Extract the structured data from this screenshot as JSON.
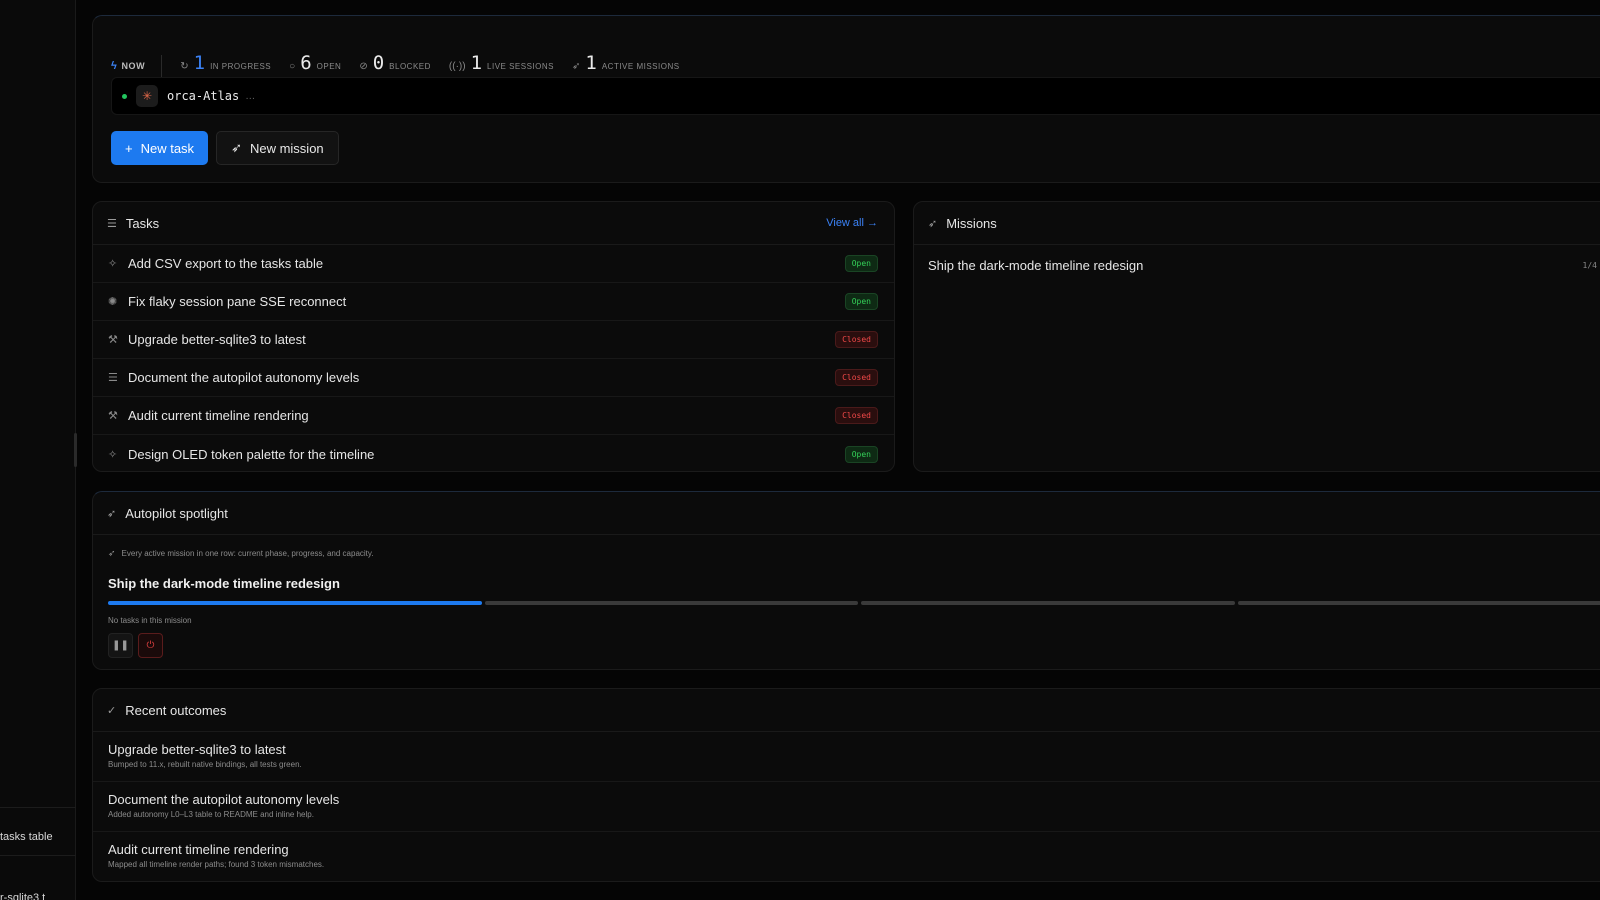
{
  "sidebar": {
    "rows": [
      "tasks table",
      "r-sqlite3 t"
    ]
  },
  "status": {
    "now_label": "NOW",
    "stats": [
      {
        "icon": "spinner-icon",
        "value": "1",
        "label": "IN PROGRESS"
      },
      {
        "icon": "circle-icon",
        "value": "6",
        "label": "OPEN"
      },
      {
        "icon": "blocked-icon",
        "value": "0",
        "label": "BLOCKED"
      },
      {
        "icon": "broadcast-icon",
        "value": "1",
        "label": "LIVE SESSIONS"
      },
      {
        "icon": "rocket-icon",
        "value": "1",
        "label": "ACTIVE MISSIONS"
      }
    ],
    "session": {
      "name": "orca-Atlas",
      "ellipsis": "…"
    },
    "buttons": {
      "new_task": "New task",
      "new_mission": "New mission"
    }
  },
  "tasks": {
    "title": "Tasks",
    "view_all": "View all →",
    "items": [
      {
        "icon": "sparkle-icon",
        "title": "Add CSV export to the tasks table",
        "status": "Open"
      },
      {
        "icon": "bug-icon",
        "title": "Fix flaky session pane SSE reconnect",
        "status": "Open"
      },
      {
        "icon": "wrench-icon",
        "title": "Upgrade better-sqlite3 to latest",
        "status": "Closed"
      },
      {
        "icon": "list-icon",
        "title": "Document the autopilot autonomy levels",
        "status": "Closed"
      },
      {
        "icon": "wrench-icon",
        "title": "Audit current timeline rendering",
        "status": "Closed"
      },
      {
        "icon": "sparkle-icon",
        "title": "Design OLED token palette for the timeline",
        "status": "Open"
      }
    ]
  },
  "missions": {
    "title": "Missions",
    "items": [
      {
        "title": "Ship the dark-mode timeline redesign",
        "progress": "1/4"
      }
    ]
  },
  "autopilot": {
    "title": "Autopilot spotlight",
    "description": "Every active mission in one row: current phase, progress, and capacity.",
    "mission_title": "Ship the dark-mode timeline redesign",
    "phases_total": 4,
    "phases_done": 1,
    "note": "No tasks in this mission"
  },
  "outcomes": {
    "title": "Recent outcomes",
    "items": [
      {
        "title": "Upgrade better-sqlite3 to latest",
        "detail": "Bumped to 11.x, rebuilt native bindings, all tests green."
      },
      {
        "title": "Document the autopilot autonomy levels",
        "detail": "Added autonomy L0–L3 table to README and inline help."
      },
      {
        "title": "Audit current timeline rendering",
        "detail": "Mapped all timeline render paths; found 3 token mismatches."
      }
    ]
  },
  "colors": {
    "accent": "#1d7af0",
    "open": "#34d058",
    "closed": "#f04848",
    "background": "#050505"
  }
}
